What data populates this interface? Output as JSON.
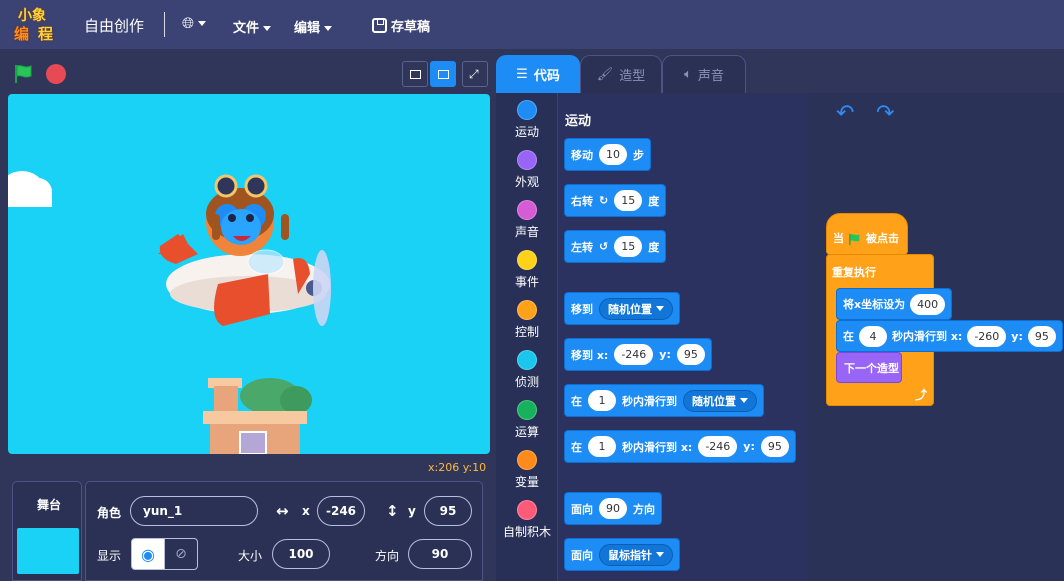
{
  "topbar": {
    "logo_line1": "小象",
    "logo_line2a": "编",
    "logo_line2b": "程",
    "title": "自由创作",
    "globe_icon": "globe-icon",
    "menu_file": "文件",
    "menu_edit": "编辑",
    "save_label": "存草稿"
  },
  "stage": {
    "coord_readout": "x:206 y:10",
    "background_color": "#1ad2f5"
  },
  "sprite_panel": {
    "stage_tab_label": "舞台",
    "sprite_label": "角色",
    "sprite_name": "yun_1",
    "x_label": "x",
    "x_value": "-246",
    "y_label": "y",
    "y_value": "95",
    "show_label": "显示",
    "size_label": "大小",
    "size_value": "100",
    "direction_label": "方向",
    "direction_value": "90"
  },
  "tabs": {
    "code": "代码",
    "costume": "造型",
    "sound": "声音"
  },
  "categories": [
    {
      "label": "运动",
      "color": "#1d8cf5"
    },
    {
      "label": "外观",
      "color": "#9865f6"
    },
    {
      "label": "声音",
      "color": "#d65cd6"
    },
    {
      "label": "事件",
      "color": "#ffd21a"
    },
    {
      "label": "控制",
      "color": "#ffa21a"
    },
    {
      "label": "侦测",
      "color": "#1ac6ec"
    },
    {
      "label": "运算",
      "color": "#17b35c"
    },
    {
      "label": "变量",
      "color": "#ff8c1a"
    },
    {
      "label": "自制积木",
      "color": "#ff5b79"
    }
  ],
  "palette": {
    "heading": "运动",
    "move": {
      "pre": "移动",
      "val": "10",
      "post": "步"
    },
    "turn_right": {
      "pre": "右转",
      "val": "15",
      "post": "度"
    },
    "turn_left": {
      "pre": "左转",
      "val": "15",
      "post": "度"
    },
    "goto": {
      "pre": "移到",
      "dd": "随机位置"
    },
    "goto_xy": {
      "pre": "移到 x:",
      "x": "-246",
      "ylbl": "y:",
      "y": "95"
    },
    "glide_rand": {
      "pre": "在",
      "val": "1",
      "mid": "秒内滑行到",
      "dd": "随机位置"
    },
    "glide_xy": {
      "pre": "在",
      "val": "1",
      "mid": "秒内滑行到 x:",
      "x": "-246",
      "ylbl": "y:",
      "y": "95"
    },
    "point_dir": {
      "pre": "面向",
      "val": "90",
      "post": "方向"
    },
    "point_to": {
      "pre": "面向",
      "dd": "鼠标指针"
    }
  },
  "script": {
    "hat_pre": "当",
    "hat_post": "被点击",
    "forever": "重复执行",
    "set_x": {
      "pre": "将x坐标设为",
      "val": "400"
    },
    "glide": {
      "pre": "在",
      "val": "4",
      "mid": "秒内滑行到 x:",
      "x": "-260",
      "ylbl": "y:",
      "y": "95"
    },
    "next_costume": "下一个造型",
    "loop_arrow": "⤴"
  }
}
